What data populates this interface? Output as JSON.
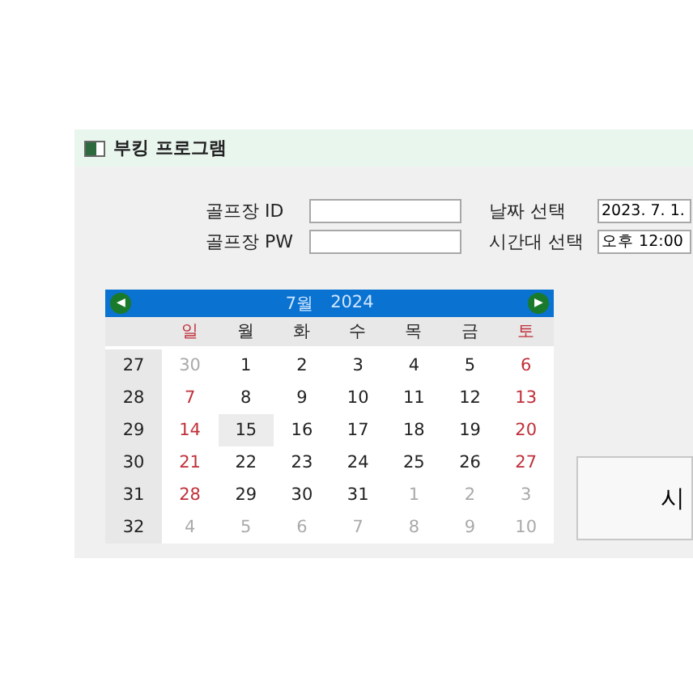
{
  "window": {
    "title": "부킹 프로그램"
  },
  "form": {
    "left": [
      {
        "label": "골프장 ID"
      },
      {
        "label": "골프장 PW"
      }
    ],
    "right": [
      {
        "label": "날짜 선택",
        "value": "2023. 7. 1."
      },
      {
        "label": "시간대 선택",
        "value": "오후 12:00"
      }
    ]
  },
  "calendar": {
    "prev": "◀",
    "next": "▶",
    "month": "7월",
    "year": "2024",
    "weekdays": [
      "일",
      "월",
      "화",
      "수",
      "목",
      "금",
      "토"
    ],
    "weeks": [
      {
        "number": "27",
        "days": [
          {
            "day": "30",
            "in_month": false,
            "selected": false
          },
          {
            "day": "1",
            "in_month": true,
            "selected": false
          },
          {
            "day": "2",
            "in_month": true,
            "selected": false
          },
          {
            "day": "3",
            "in_month": true,
            "selected": false
          },
          {
            "day": "4",
            "in_month": true,
            "selected": false
          },
          {
            "day": "5",
            "in_month": true,
            "selected": false
          },
          {
            "day": "6",
            "in_month": true,
            "selected": false
          }
        ]
      },
      {
        "number": "28",
        "days": [
          {
            "day": "7",
            "in_month": true,
            "selected": false
          },
          {
            "day": "8",
            "in_month": true,
            "selected": false
          },
          {
            "day": "9",
            "in_month": true,
            "selected": false
          },
          {
            "day": "10",
            "in_month": true,
            "selected": false
          },
          {
            "day": "11",
            "in_month": true,
            "selected": false
          },
          {
            "day": "12",
            "in_month": true,
            "selected": false
          },
          {
            "day": "13",
            "in_month": true,
            "selected": false
          }
        ]
      },
      {
        "number": "29",
        "days": [
          {
            "day": "14",
            "in_month": true,
            "selected": false
          },
          {
            "day": "15",
            "in_month": true,
            "selected": true
          },
          {
            "day": "16",
            "in_month": true,
            "selected": false
          },
          {
            "day": "17",
            "in_month": true,
            "selected": false
          },
          {
            "day": "18",
            "in_month": true,
            "selected": false
          },
          {
            "day": "19",
            "in_month": true,
            "selected": false
          },
          {
            "day": "20",
            "in_month": true,
            "selected": false
          }
        ]
      },
      {
        "number": "30",
        "days": [
          {
            "day": "21",
            "in_month": true,
            "selected": false
          },
          {
            "day": "22",
            "in_month": true,
            "selected": false
          },
          {
            "day": "23",
            "in_month": true,
            "selected": false
          },
          {
            "day": "24",
            "in_month": true,
            "selected": false
          },
          {
            "day": "25",
            "in_month": true,
            "selected": false
          },
          {
            "day": "26",
            "in_month": true,
            "selected": false
          },
          {
            "day": "27",
            "in_month": true,
            "selected": false
          }
        ]
      },
      {
        "number": "31",
        "days": [
          {
            "day": "28",
            "in_month": true,
            "selected": false
          },
          {
            "day": "29",
            "in_month": true,
            "selected": false
          },
          {
            "day": "30",
            "in_month": true,
            "selected": false
          },
          {
            "day": "31",
            "in_month": true,
            "selected": false
          },
          {
            "day": "1",
            "in_month": false,
            "selected": false
          },
          {
            "day": "2",
            "in_month": false,
            "selected": false
          },
          {
            "day": "3",
            "in_month": false,
            "selected": false
          }
        ]
      },
      {
        "number": "32",
        "days": [
          {
            "day": "4",
            "in_month": false,
            "selected": false
          },
          {
            "day": "5",
            "in_month": false,
            "selected": false
          },
          {
            "day": "6",
            "in_month": false,
            "selected": false
          },
          {
            "day": "7",
            "in_month": false,
            "selected": false
          },
          {
            "day": "8",
            "in_month": false,
            "selected": false
          },
          {
            "day": "9",
            "in_month": false,
            "selected": false
          },
          {
            "day": "10",
            "in_month": false,
            "selected": false
          }
        ]
      }
    ]
  },
  "action_button": "시"
}
